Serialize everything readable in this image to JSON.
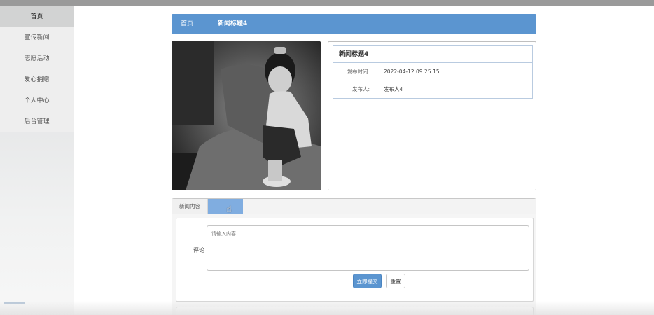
{
  "sidebar": {
    "items": [
      {
        "label": "首页",
        "active": true
      },
      {
        "label": "宣传新闻",
        "active": false
      },
      {
        "label": "志愿活动",
        "active": false
      },
      {
        "label": "爱心捐赠",
        "active": false
      },
      {
        "label": "个人中心",
        "active": false
      },
      {
        "label": "后台管理",
        "active": false
      }
    ]
  },
  "breadcrumb": {
    "home": "首页",
    "current": "新闻标题4"
  },
  "news": {
    "image_alt": "black-and-white-photo-of-child",
    "title": "新闻标题4",
    "publish_time_label": "发布时间:",
    "publish_time": "2022-04-12 09:25:15",
    "publisher_label": "发布人:",
    "publisher": "发布人4"
  },
  "tabs": {
    "news_content": "新闻内容",
    "comment": ""
  },
  "comment_form": {
    "label": "评论",
    "placeholder": "请输入内容",
    "submit": "立即提交",
    "reset": "重置"
  },
  "colors": {
    "accent": "#5b95d0",
    "tab_active": "#80ade0"
  }
}
